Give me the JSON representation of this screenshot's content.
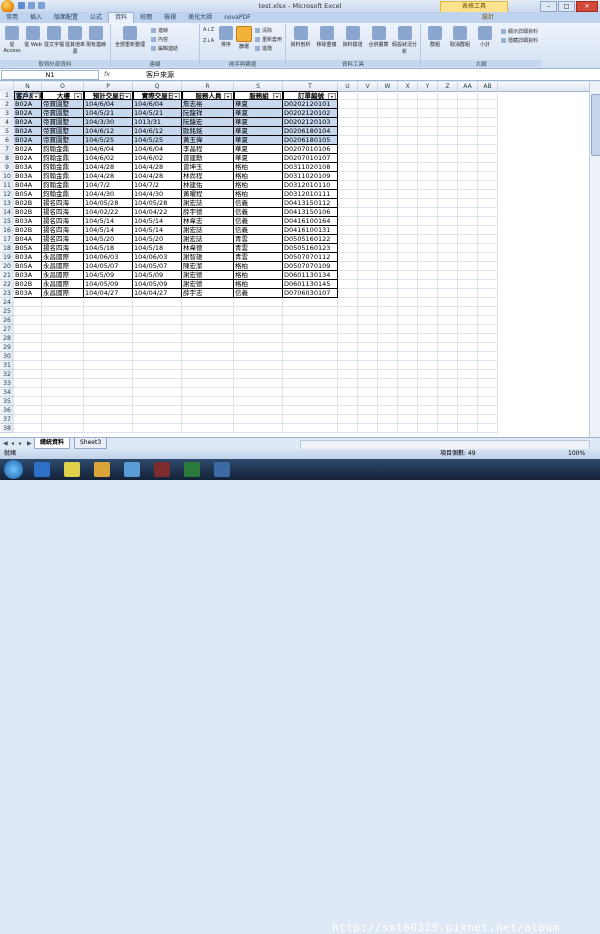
{
  "window": {
    "title": "test.xlsx - Microsoft Excel",
    "context_tab_title": "表格工具"
  },
  "tabs": [
    "常用",
    "插入",
    "版面配置",
    "公式",
    "資料",
    "校閱",
    "檢視",
    "美化大師",
    "novaPDF",
    "設計"
  ],
  "active_tab": "資料",
  "ribbon": {
    "groups": [
      "取得外部資料",
      "連線",
      "排序與篩選",
      "資料工具",
      "大綱"
    ],
    "external": [
      "從 Access",
      "從 Web",
      "從文字檔",
      "從其他來源",
      "現有連線"
    ],
    "connections": {
      "refresh_all": "全部重新整理",
      "connections": "連線",
      "properties": "內容",
      "edit_links": "編輯連結"
    },
    "sort_filter": {
      "sort_az": "A↓Z",
      "sort_za": "Z↓A",
      "sort": "排序",
      "filter": "篩選",
      "clear": "清除",
      "reapply": "重新套用",
      "advanced": "進階"
    },
    "data_tools": [
      "資料剖析",
      "移除重複",
      "資料驗證",
      "合併彙算",
      "假設狀況分析"
    ],
    "outline": [
      "群組",
      "取消群組",
      "小計"
    ],
    "outline_small": [
      "顯示詳細資料",
      "隱藏詳細資料"
    ]
  },
  "formula_bar": {
    "name_box": "N1",
    "fx": "fx",
    "value": "客戶來源"
  },
  "columns": [
    "N",
    "O",
    "P",
    "Q",
    "R",
    "S",
    "T",
    "U",
    "V",
    "W",
    "X",
    "Y",
    "Z",
    "AA",
    "AB"
  ],
  "rows": [
    "1",
    "2",
    "3",
    "4",
    "5",
    "6",
    "7",
    "8",
    "9",
    "10",
    "11",
    "12",
    "13",
    "14",
    "15",
    "16",
    "17",
    "18",
    "19",
    "20",
    "21",
    "22",
    "23",
    "24",
    "25",
    "26",
    "27",
    "28",
    "29",
    "30",
    "31",
    "32",
    "33",
    "34",
    "35",
    "36",
    "37",
    "38"
  ],
  "table": {
    "headers": [
      "客戶來源",
      "大樓",
      "預計交屋日",
      "實際交屋日",
      "服務人員",
      "服務組",
      "訂單編號"
    ],
    "rows": [
      [
        "B02A",
        "帝寶園墅",
        "104/6/04",
        "104/6/04",
        "詹志裕",
        "華夏",
        "D0202120101"
      ],
      [
        "B02A",
        "帝寶園墅",
        "104/5/21",
        "104/5/21",
        "阮龍祥",
        "華夏",
        "D0202120102"
      ],
      [
        "B02A",
        "帝寶園墅",
        "104/3/30",
        "1013/31",
        "阮龍宏",
        "華夏",
        "D0202120103"
      ],
      [
        "B02A",
        "帝寶園墅",
        "104/6/12",
        "104/6/12",
        "歐銘銘",
        "華夏",
        "D0206180104"
      ],
      [
        "B02A",
        "帝寶園墅",
        "104/5/25",
        "104/5/25",
        "黃玉偉",
        "華夏",
        "D0206180105"
      ],
      [
        "B02A",
        "鈞翰金鼎",
        "104/6/04",
        "104/6/04",
        "李晶程",
        "華夏",
        "D0207010106"
      ],
      [
        "B02A",
        "鈞翰金鼎",
        "104/6/02",
        "104/6/02",
        "曾建勳",
        "華夏",
        "D0207010107"
      ],
      [
        "B03A",
        "鈞翰金鼎",
        "104/4/28",
        "104/4/28",
        "曾坤玉",
        "格柏",
        "D0311020108"
      ],
      [
        "B03A",
        "鈞翰金鼎",
        "104/4/28",
        "104/4/28",
        "林尚程",
        "格柏",
        "D0311020109"
      ],
      [
        "B04A",
        "鈞翰金鼎",
        "104/7/2",
        "104/7/2",
        "林建佑",
        "格柏",
        "D0312010110"
      ],
      [
        "B05A",
        "鈞翰金鼎",
        "104/4/30",
        "104/4/30",
        "黃曜程",
        "格柏",
        "D0312010111"
      ],
      [
        "B02B",
        "揚名四海",
        "104/05/28",
        "104/05/28",
        "謝宏誌",
        "信義",
        "D0413150112"
      ],
      [
        "B02B",
        "揚名四海",
        "104/02/22",
        "104/04/22",
        "薛宇德",
        "信義",
        "D0413150106"
      ],
      [
        "B03A",
        "揚名四海",
        "104/5/14",
        "104/5/14",
        "林韋志",
        "信義",
        "D0416100164"
      ],
      [
        "B02B",
        "揚名四海",
        "104/5/14",
        "104/5/14",
        "謝宏誌",
        "信義",
        "D0416100131"
      ],
      [
        "B04A",
        "揚名四海",
        "104/5/20",
        "104/5/20",
        "謝宏誌",
        "青雲",
        "D0505160122"
      ],
      [
        "B05A",
        "揚名四海",
        "104/5/18",
        "104/5/18",
        "林韋德",
        "青雲",
        "D0505160123"
      ],
      [
        "B03A",
        "永昌國際",
        "104/06/03",
        "104/06/03",
        "謝智雄",
        "青雲",
        "D0507070112"
      ],
      [
        "B05A",
        "永昌國際",
        "104/05/07",
        "104/05/07",
        "陳宏潔",
        "格柏",
        "D0507070109"
      ],
      [
        "B03A",
        "永昌國際",
        "104/5/09",
        "104/5/09",
        "謝宏德",
        "格柏",
        "D0601130134"
      ],
      [
        "B02B",
        "永昌國際",
        "104/05/09",
        "104/05/09",
        "謝宏德",
        "格柏",
        "D0601130145"
      ],
      [
        "B03A",
        "永昌國際",
        "104/04/27",
        "104/04/27",
        "薛宇志",
        "信義",
        "D0706030107"
      ]
    ]
  },
  "sheet_tabs": [
    "總統資料",
    "Sheet3"
  ],
  "active_sheet_tab": "總統資料",
  "status": {
    "left": "就緒",
    "count": "項目個數: 49",
    "zoom": "100%"
  },
  "watermark": "http://sxt66329.pixnet.net/album"
}
